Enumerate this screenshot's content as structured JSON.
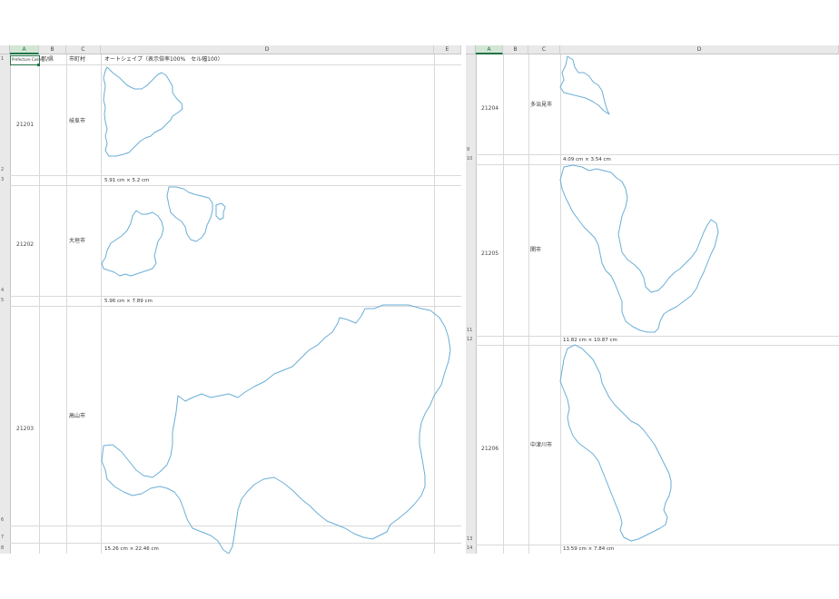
{
  "left_sheet": {
    "columns": [
      "A",
      "B",
      "C",
      "D",
      "E"
    ],
    "selected_column": "A",
    "header_row": {
      "row_number": "1",
      "a": "Prefecture Code",
      "b": "郡/県",
      "c": "市町村",
      "d": "オートシェイプ（表示倍率100%　セル幅100）"
    },
    "rows": [
      {
        "num": "2",
        "code": "21201",
        "name": "岐阜市",
        "meas_row": "3",
        "measurement": "5.91 cm × 5.2 cm"
      },
      {
        "num": "4",
        "code": "21202",
        "name": "大垣市",
        "meas_row": "5",
        "measurement": "5.96 cm × 7.89 cm"
      },
      {
        "num": "6",
        "code": "21203",
        "name": "高山市",
        "extra_row": "7",
        "meas_row": "8",
        "measurement": "15.26 cm × 22.46 cm"
      }
    ]
  },
  "right_sheet": {
    "columns": [
      "A",
      "B",
      "C",
      "D"
    ],
    "selected_column": "A",
    "rows": [
      {
        "num": "9",
        "code": "21204",
        "name": "多治見市",
        "meas_row": "10",
        "measurement": "4.09 cm × 3.54 cm"
      },
      {
        "num": "11",
        "code": "21205",
        "name": "関市",
        "meas_row": "12",
        "measurement": "11.82 cm × 10.87 cm"
      },
      {
        "num": "13",
        "code": "21206",
        "name": "中津川市",
        "meas_row": "14",
        "measurement": "13.59 cm × 7.84 cm"
      }
    ]
  },
  "colors": {
    "shape_outline": "#6aaed6",
    "selection": "#217346",
    "header_bg": "#e9e9e9",
    "grid": "#d9d9d9"
  }
}
